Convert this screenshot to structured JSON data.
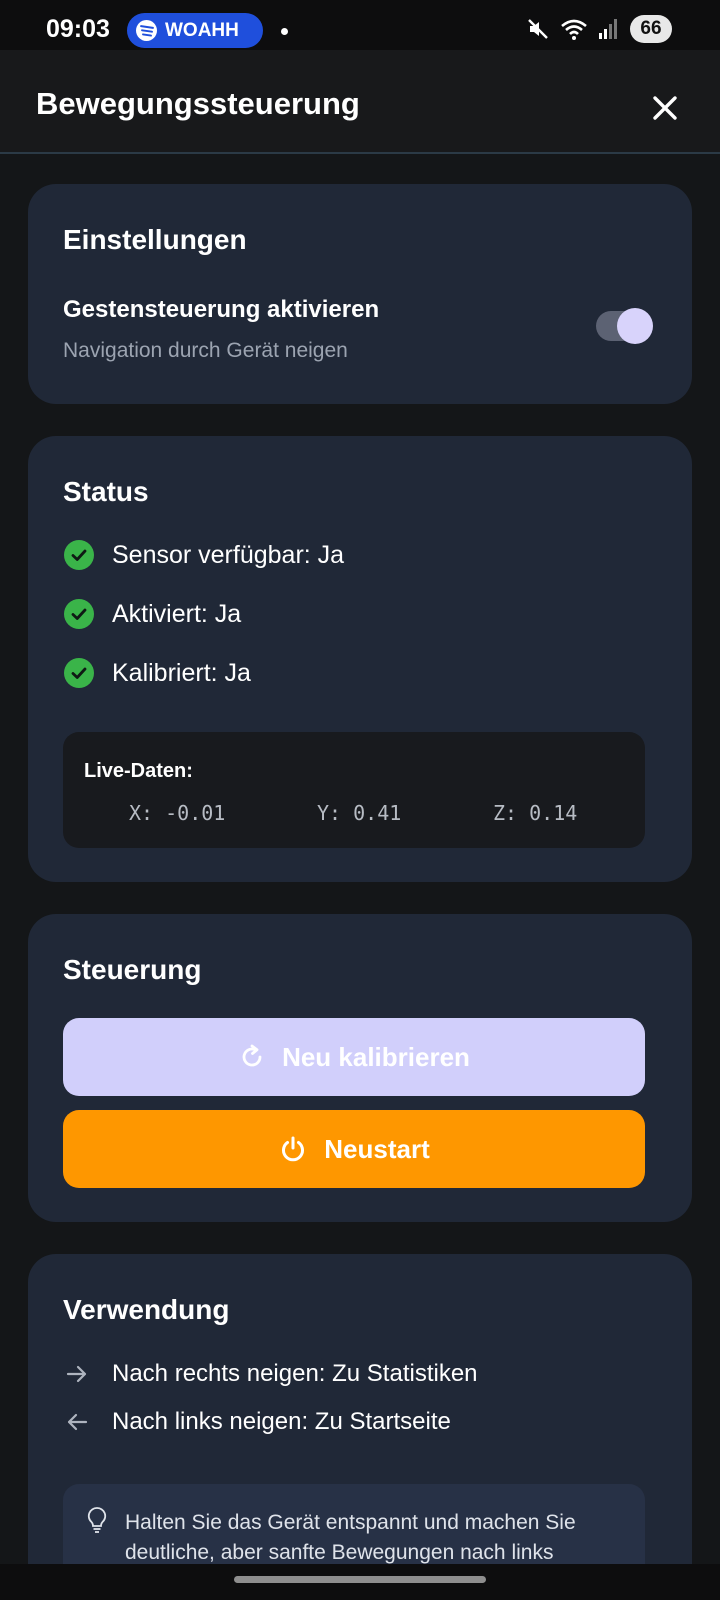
{
  "status_bar": {
    "time": "09:03",
    "media_pill": "WOAHH",
    "media_icon": "spotify-icon",
    "battery": "66"
  },
  "header": {
    "title": "Bewegungssteuerung",
    "close_icon": "close-icon"
  },
  "settings": {
    "title": "Einstellungen",
    "gesture_label": "Gestensteuerung aktivieren",
    "gesture_desc": "Navigation durch Gerät neigen",
    "gesture_enabled": true
  },
  "status": {
    "title": "Status",
    "items": [
      {
        "label": "Sensor verfügbar: Ja"
      },
      {
        "label": "Aktiviert: Ja"
      },
      {
        "label": "Kalibriert: Ja"
      }
    ],
    "live": {
      "title": "Live-Daten:",
      "x": "X: -0.01",
      "y": "Y: 0.41",
      "z": "Z: 0.14"
    }
  },
  "control": {
    "title": "Steuerung",
    "calibrate_label": "Neu kalibrieren",
    "restart_label": "Neustart"
  },
  "usage": {
    "title": "Verwendung",
    "items": [
      {
        "label": "Nach rechts neigen: Zu Statistiken",
        "icon": "arrow-right-icon"
      },
      {
        "label": "Nach links neigen: Zu Startseite",
        "icon": "arrow-left-icon"
      }
    ],
    "tip": "Halten Sie das Gerät entspannt und machen Sie deutliche, aber sanfte Bewegungen nach links"
  },
  "colors": {
    "background": "#141618",
    "card": "#202837",
    "accent_lavender": "#d1cffb",
    "accent_orange": "#fe9700",
    "success": "#3ab449"
  }
}
